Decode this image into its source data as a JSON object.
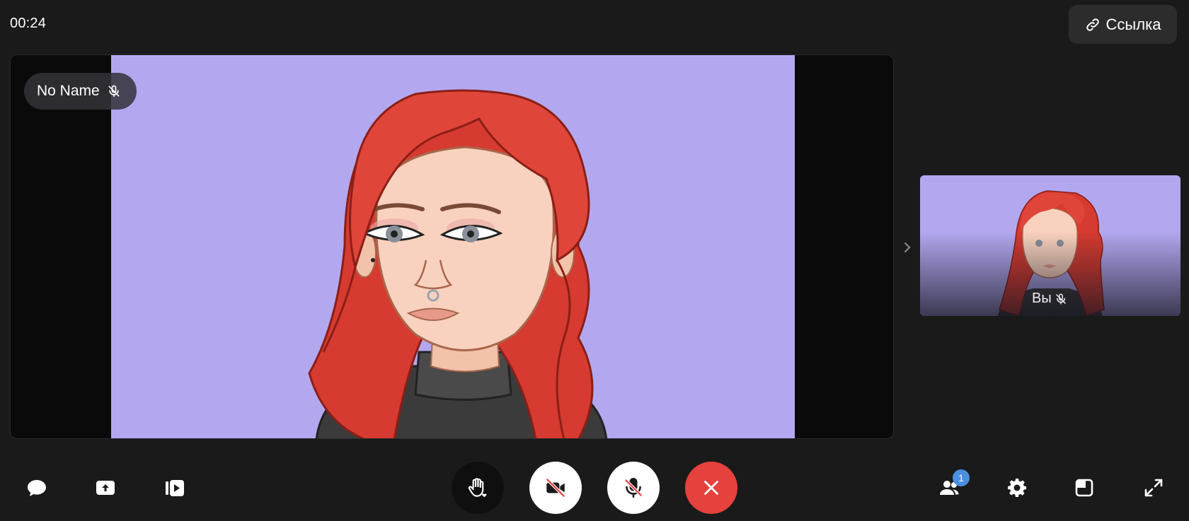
{
  "header": {
    "timer": "00:24",
    "link_label": "Ссылка"
  },
  "main_video": {
    "participant_name": "No Name",
    "background_color": "#b3a8f0"
  },
  "self_view": {
    "label": "Вы"
  },
  "toolbar_left": [
    {
      "icon": "chat-icon"
    },
    {
      "icon": "screen-share-icon"
    },
    {
      "icon": "media-icon"
    }
  ],
  "controls": [
    {
      "icon": "raise-hand-icon",
      "style": "dark"
    },
    {
      "icon": "camera-off-icon",
      "style": "light"
    },
    {
      "icon": "mic-off-icon",
      "style": "light"
    },
    {
      "icon": "end-call-icon",
      "style": "danger"
    }
  ],
  "toolbar_right": {
    "participants_count": "1"
  },
  "colors": {
    "background": "#1a1a1a",
    "end_call": "#e5413d",
    "badge": "#4a8fe0",
    "hair": "#d63a30"
  }
}
